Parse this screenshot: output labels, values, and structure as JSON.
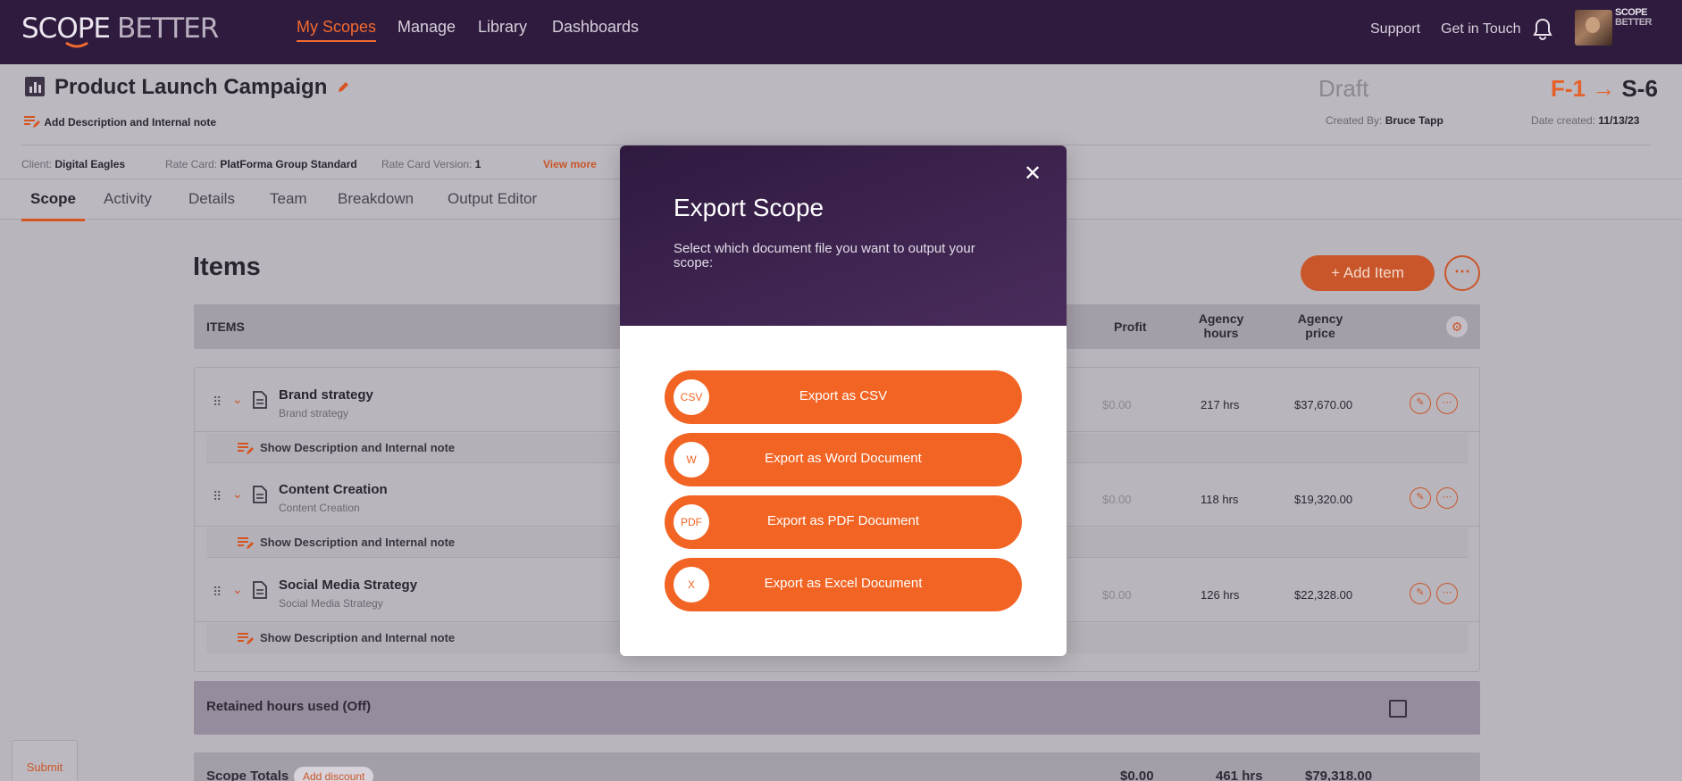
{
  "app": {
    "logo_part1": "SCOPE",
    "logo_part2": "BETTER",
    "brandmini_line1": "SCOPE",
    "brandmini_line2": "BETTER"
  },
  "nav": {
    "items": [
      "My Scopes",
      "Manage",
      "Library",
      "Dashboards"
    ],
    "active": "My Scopes"
  },
  "topright": {
    "support": "Support",
    "get_in_touch": "Get in Touch"
  },
  "scope": {
    "title": "Product Launch Campaign",
    "add_desc": "Add Description and Internal note",
    "status": "Draft",
    "code_from": "F-1",
    "code_arrow": "→",
    "code_to": "S-6",
    "created_by_label": "Created By:",
    "created_by": "Bruce Tapp",
    "date_created_label": "Date created:",
    "date_created": "11/13/23",
    "client_label": "Client:",
    "client": "Digital Eagles",
    "rate_card_label": "Rate Card:",
    "rate_card": "PlatForma Group Standard",
    "rate_card_version_label": "Rate Card Version:",
    "rate_card_version": "1",
    "view_more": "View more"
  },
  "tabs": [
    "Scope",
    "Activity",
    "Details",
    "Team",
    "Breakdown",
    "Output Editor"
  ],
  "items_section": {
    "title": "Items",
    "add_item": "+ Add Item",
    "more": "⋯",
    "columns": {
      "items": "ITEMS",
      "profit": "Profit",
      "agency_hours_1": "Agency",
      "agency_hours_2": "hours",
      "agency_price_1": "Agency",
      "agency_price_2": "price"
    },
    "rows": [
      {
        "name": "Brand strategy",
        "sub": "Brand strategy",
        "profit": "$0.00",
        "hours": "217 hrs",
        "price": "$37,670.00"
      },
      {
        "name": "Content Creation",
        "sub": "Content Creation",
        "profit": "$0.00",
        "hours": "118 hrs",
        "price": "$19,320.00"
      },
      {
        "name": "Social Media Strategy",
        "sub": "Social Media Strategy",
        "profit": "$0.00",
        "hours": "126 hrs",
        "price": "$22,328.00"
      }
    ],
    "show_desc": "Show Description and Internal note",
    "retained": "Retained hours used (Off)",
    "totals": {
      "label": "Scope Totals",
      "add_discount": "Add discount",
      "profit": "$0.00",
      "hours": "461 hrs",
      "price": "$79,318.00"
    }
  },
  "submit": "Submit",
  "modal": {
    "title": "Export Scope",
    "description": "Select which document file you want to output your scope:",
    "close": "✕",
    "buttons": [
      {
        "badge": "CSV",
        "label": "Export as CSV"
      },
      {
        "badge": "W",
        "label": "Export as Word Document"
      },
      {
        "badge": "PDF",
        "label": "Export as PDF Document"
      },
      {
        "badge": "X",
        "label": "Export as Excel Document"
      }
    ]
  },
  "colors": {
    "topbar": "#2e1b3d",
    "accent": "#f26423",
    "modal_header": "#3b2350"
  }
}
